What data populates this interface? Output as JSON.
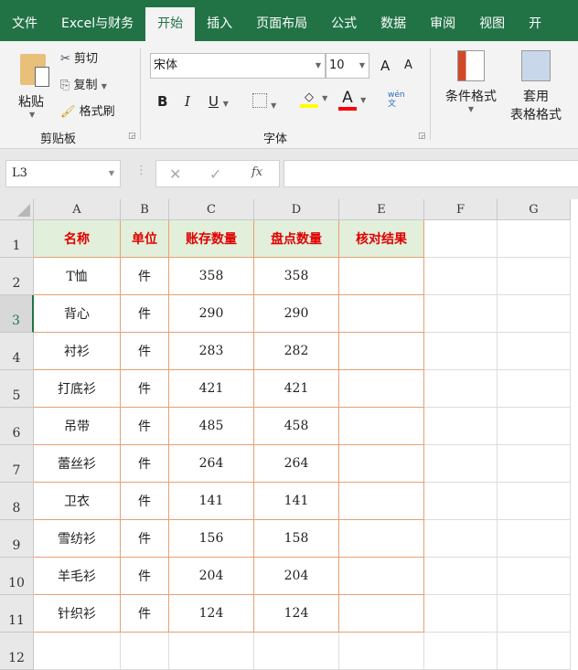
{
  "menu": {
    "tabs": [
      "文件",
      "Excel与财务",
      "开始",
      "插入",
      "页面布局",
      "公式",
      "数据",
      "审阅",
      "视图",
      "开"
    ],
    "active": "开始"
  },
  "ribbon": {
    "clipboard": {
      "paste": "粘贴",
      "cut": "剪切",
      "copy": "复制",
      "format_painter": "格式刷",
      "label": "剪贴板"
    },
    "font": {
      "name": "宋体",
      "size": "10",
      "bold": "B",
      "italic": "I",
      "underline": "U",
      "font_color": "A",
      "phonetic": "wén\n文",
      "grow": "A",
      "shrink": "A",
      "label": "字体",
      "highlight_color": "#ffff00",
      "text_color": "#ff0000"
    },
    "styles": {
      "conditional": "条件格式",
      "table_format_1": "套用",
      "table_format_2": "表格格式"
    }
  },
  "formula_bar": {
    "name_box": "L3",
    "cancel": "✕",
    "enter": "✓",
    "fx": "fx",
    "formula": ""
  },
  "sheet": {
    "columns": [
      "A",
      "B",
      "C",
      "D",
      "E",
      "F",
      "G"
    ],
    "rows": [
      "1",
      "2",
      "3",
      "4",
      "5",
      "6",
      "7",
      "8",
      "9",
      "10",
      "11",
      "12"
    ],
    "selected_row": "3",
    "header": [
      "名称",
      "单位",
      "账存数量",
      "盘点数量",
      "核对结果"
    ],
    "data": [
      [
        "T恤",
        "件",
        "358",
        "358",
        ""
      ],
      [
        "背心",
        "件",
        "290",
        "290",
        ""
      ],
      [
        "衬衫",
        "件",
        "283",
        "282",
        ""
      ],
      [
        "打底衫",
        "件",
        "421",
        "421",
        ""
      ],
      [
        "吊带",
        "件",
        "485",
        "458",
        ""
      ],
      [
        "蕾丝衫",
        "件",
        "264",
        "264",
        ""
      ],
      [
        "卫衣",
        "件",
        "141",
        "141",
        ""
      ],
      [
        "雪纺衫",
        "件",
        "156",
        "158",
        ""
      ],
      [
        "羊毛衫",
        "件",
        "204",
        "204",
        ""
      ],
      [
        "针织衫",
        "件",
        "124",
        "124",
        ""
      ]
    ]
  }
}
